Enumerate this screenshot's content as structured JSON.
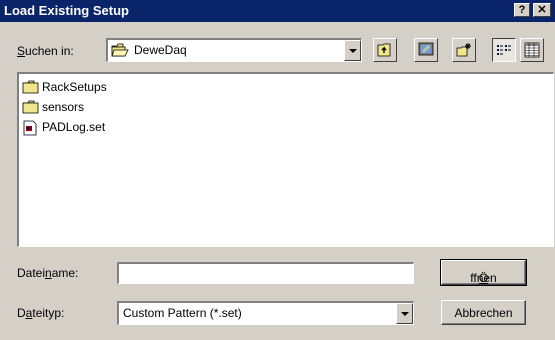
{
  "window": {
    "title": "Load Existing Setup",
    "help_glyph": "?",
    "close_glyph": "✕"
  },
  "lookin": {
    "label_underlined": "S",
    "label_rest": "uchen in:",
    "folder": "DeweDaq"
  },
  "files": [
    {
      "name": "RackSetups",
      "icon": "folder-icon"
    },
    {
      "name": "sensors",
      "icon": "folder-icon"
    },
    {
      "name": "PADLog.set",
      "icon": "document-icon"
    }
  ],
  "filename": {
    "label_pre": "Datei",
    "label_underlined": "n",
    "label_post": "ame:",
    "value": ""
  },
  "filetype": {
    "label_pre": "D",
    "label_underlined": "a",
    "label_post": "teityp:",
    "value": "Custom Pattern (*.set)"
  },
  "buttons": {
    "open_underlined": "Ö",
    "open_rest": "ffnen",
    "cancel": "Abbrechen"
  },
  "colors": {
    "titlebar": "#0a246a",
    "face": "#d4d0c8",
    "folder": "#f0e68c"
  }
}
